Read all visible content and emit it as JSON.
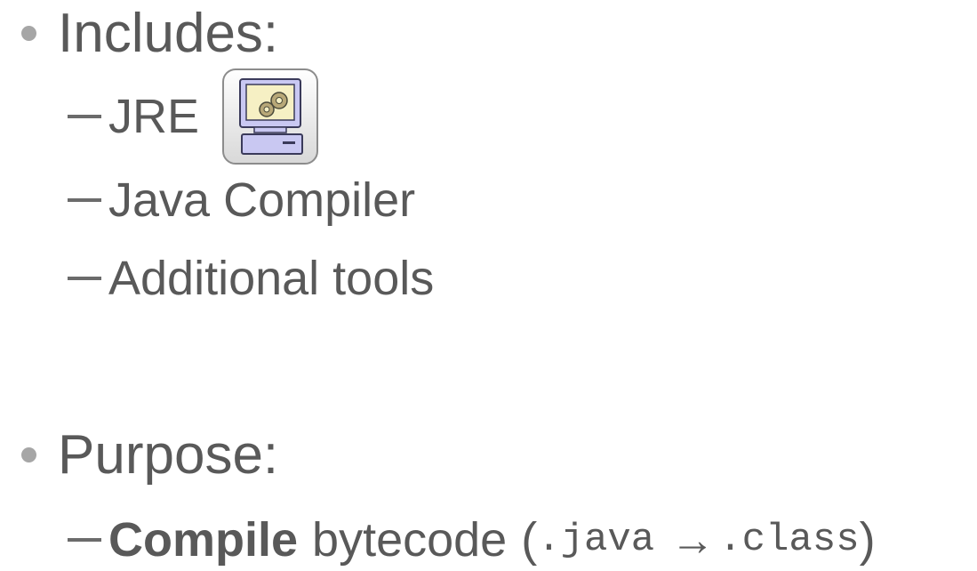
{
  "sections": [
    {
      "heading": "Includes:",
      "items": [
        {
          "label": "JRE",
          "icon": "computer-gears-icon"
        },
        {
          "label": "Java Compiler"
        },
        {
          "label": "Additional tools"
        }
      ]
    },
    {
      "heading": "Purpose:",
      "items": [
        {
          "bold": "Compile",
          "label": "bytecode",
          "open_paren": "(",
          "from_ext": ".java",
          "arrow": "→",
          "to_ext": ".class",
          "close_paren": ")"
        }
      ]
    }
  ],
  "colors": {
    "text": "#595959",
    "bullet": "#a6a6a6",
    "icon_monitor": "#c8c8f0",
    "icon_screen": "#f5efc0"
  }
}
